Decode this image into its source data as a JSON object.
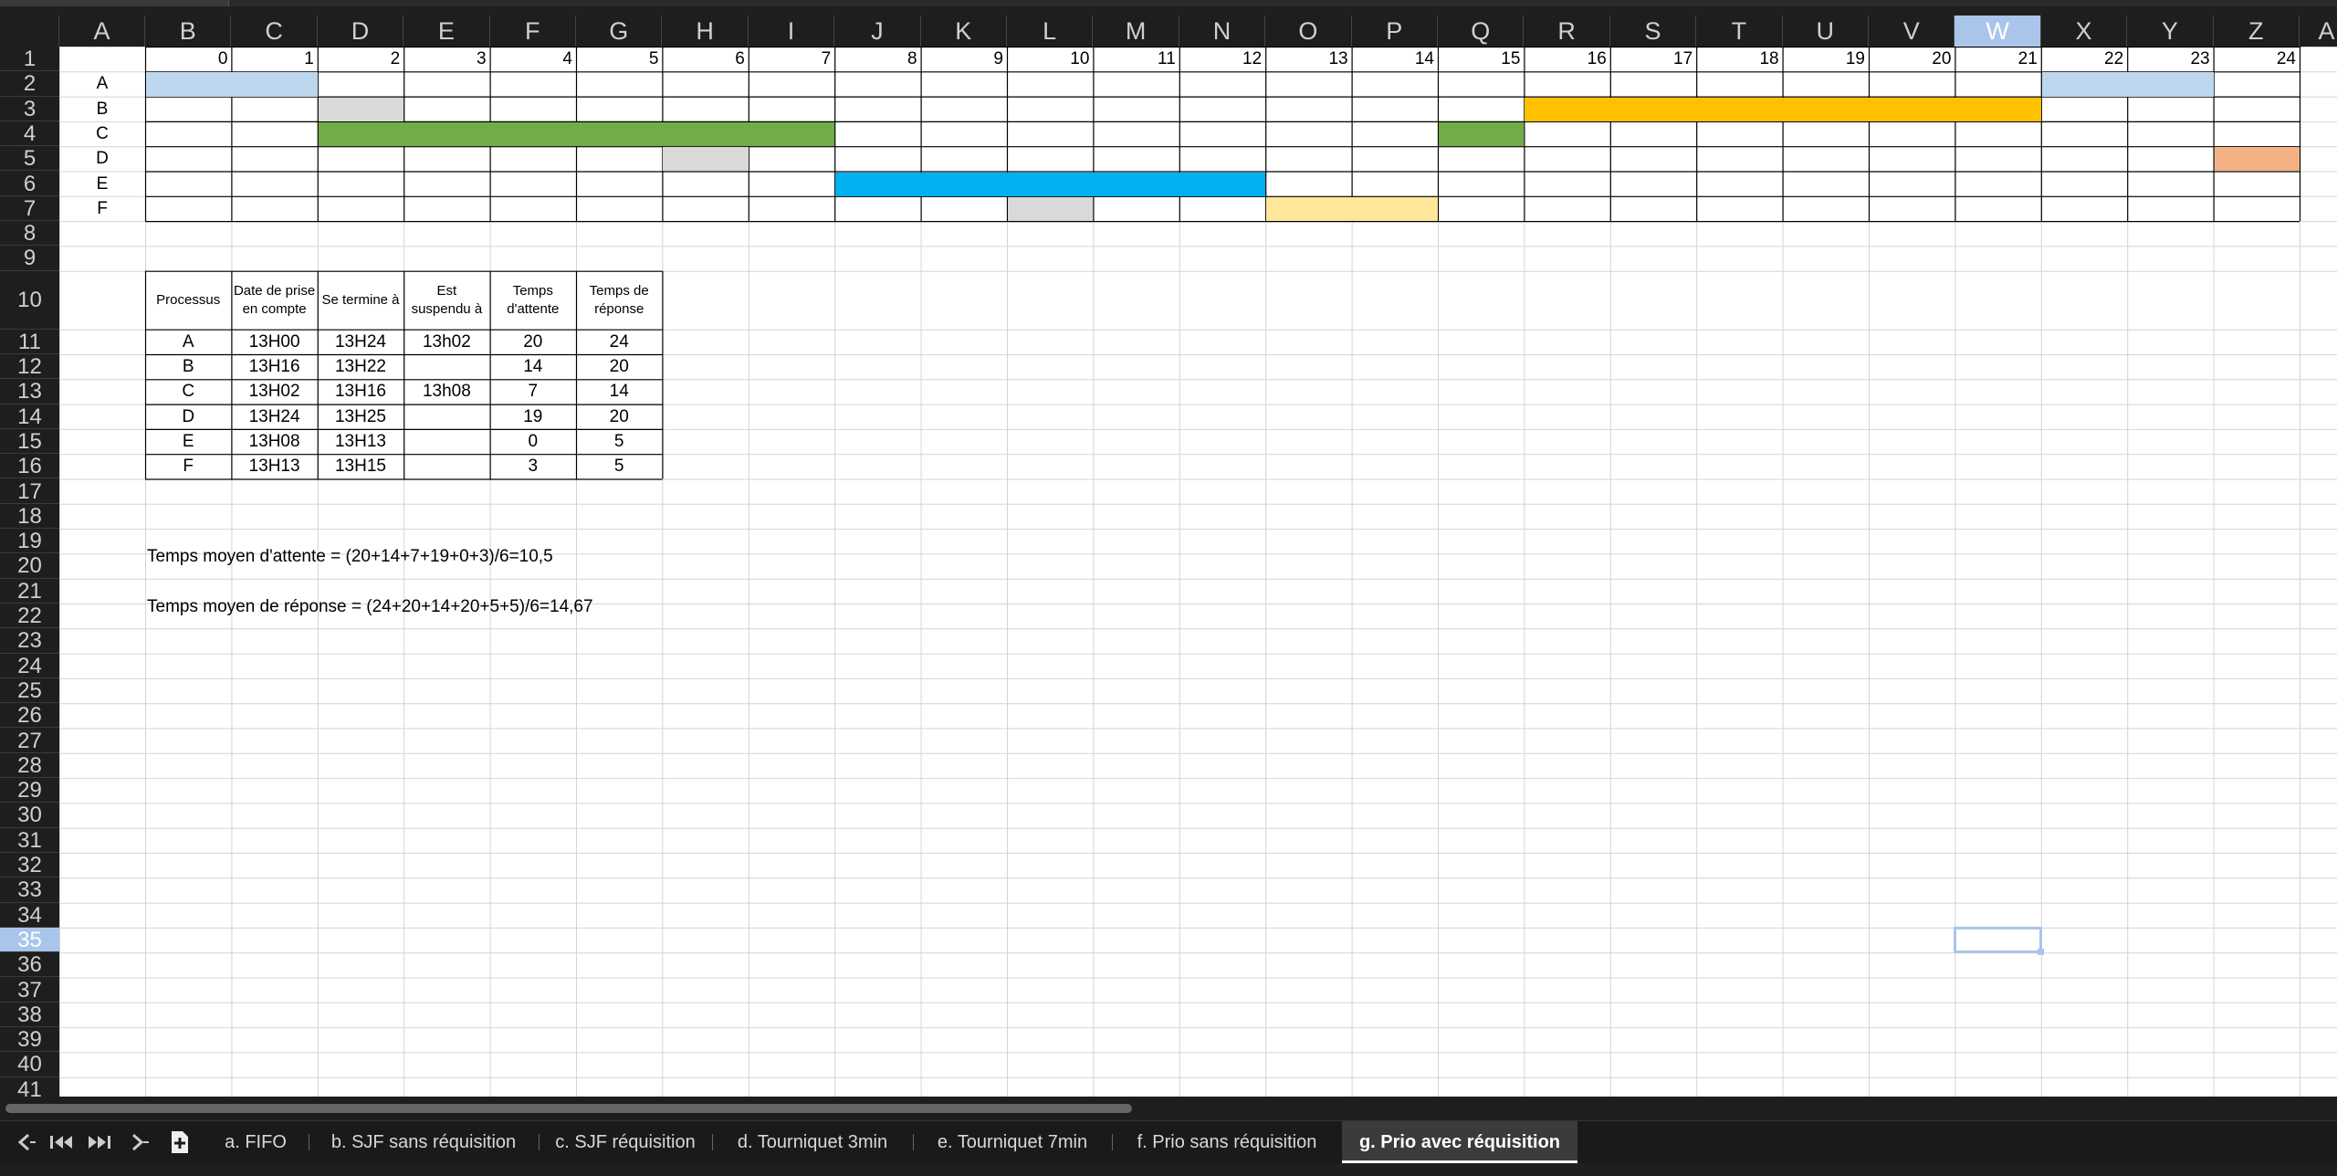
{
  "columns": [
    "A",
    "B",
    "C",
    "D",
    "E",
    "F",
    "G",
    "H",
    "I",
    "J",
    "K",
    "L",
    "M",
    "N",
    "O",
    "P",
    "Q",
    "R",
    "S",
    "T",
    "U",
    "V",
    "W",
    "X",
    "Y",
    "Z",
    "A"
  ],
  "selected_column": "W",
  "row_labels": [
    "1",
    "2",
    "3",
    "4",
    "5",
    "6",
    "7",
    "8",
    "9",
    "10",
    "11",
    "12",
    "13",
    "14",
    "15",
    "16",
    "17",
    "18",
    "19",
    "20",
    "21",
    "22",
    "23",
    "24",
    "25",
    "26",
    "27",
    "28",
    "29",
    "30",
    "31",
    "32",
    "33",
    "34",
    "35",
    "36",
    "37",
    "38",
    "39",
    "40",
    "41"
  ],
  "selected_row": "35",
  "timeline": {
    "ticks": [
      "0",
      "1",
      "2",
      "3",
      "4",
      "5",
      "6",
      "7",
      "8",
      "9",
      "10",
      "11",
      "12",
      "13",
      "14",
      "15",
      "16",
      "17",
      "18",
      "19",
      "20",
      "21",
      "22",
      "23",
      "24"
    ],
    "process_labels": [
      "A",
      "B",
      "C",
      "D",
      "E",
      "F"
    ],
    "colors": {
      "light_blue": "#bdd7ee",
      "grey": "#d9d9d9",
      "green": "#70ad47",
      "orange": "#ffc000",
      "blue": "#00b0f0",
      "yellow": "#ffe699",
      "salmon": "#f4b183"
    }
  },
  "table": {
    "headers": [
      "Processus",
      "Date de prise en compte",
      "Se termine à",
      "Est suspendu à",
      "Temps d'attente",
      "Temps de réponse"
    ],
    "rows": [
      [
        "A",
        "13H00",
        "13H24",
        "13h02",
        "20",
        "24"
      ],
      [
        "B",
        "13H16",
        "13H22",
        "",
        "14",
        "20"
      ],
      [
        "C",
        "13H02",
        "13H16",
        "13h08",
        "7",
        "14"
      ],
      [
        "D",
        "13H24",
        "13H25",
        "",
        "19",
        "20"
      ],
      [
        "E",
        "13H08",
        "13H13",
        "",
        "0",
        "5"
      ],
      [
        "F",
        "13H13",
        "13H15",
        "",
        "3",
        "5"
      ]
    ]
  },
  "notes": {
    "avg_wait": "Temps moyen d'attente = (20+14+7+19+0+3)/6=10,5",
    "avg_response": "Temps moyen de réponse = (24+20+14+20+5+5)/6=14,67"
  },
  "sheet_tabs": [
    {
      "label": "a. FIFO",
      "active": false
    },
    {
      "label": "b. SJF sans réquisition",
      "active": false
    },
    {
      "label": "c. SJF réquisition",
      "active": false
    },
    {
      "label": "d. Tourniquet 3min",
      "active": false
    },
    {
      "label": "e. Tourniquet 7min",
      "active": false
    },
    {
      "label": "f. Prio sans réquisition",
      "active": false
    },
    {
      "label": "g. Prio avec réquisition",
      "active": true
    }
  ],
  "nav_icons": [
    "prev-sheet-icon",
    "first-sheet-icon",
    "last-sheet-icon",
    "next-sheet-icon",
    "add-sheet-icon"
  ]
}
